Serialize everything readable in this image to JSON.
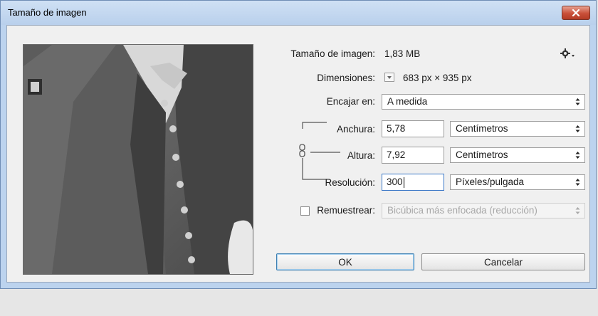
{
  "window": {
    "title": "Tamaño de imagen",
    "close_icon": "close-icon"
  },
  "image_size": {
    "label": "Tamaño de imagen:",
    "value": "1,83 MB"
  },
  "dimensions": {
    "label": "Dimensiones:",
    "value": "683 px × 935 px"
  },
  "fit_to": {
    "label": "Encajar en:",
    "selected": "A medida"
  },
  "width": {
    "label": "Anchura:",
    "value": "5,78",
    "unit": "Centímetros"
  },
  "height": {
    "label": "Altura:",
    "value": "7,92",
    "unit": "Centímetros"
  },
  "resolution": {
    "label": "Resolución:",
    "value": "300",
    "unit": "Píxeles/pulgada"
  },
  "resample": {
    "label": "Remuestrear:",
    "checked": false,
    "method": "Bicúbica más enfocada (reducción)"
  },
  "buttons": {
    "ok": "OK",
    "cancel": "Cancelar"
  },
  "colors": {
    "titlebar": "#bcd3ee",
    "client": "#f0f0f0",
    "close": "#c9503a",
    "focus": "#3b78c7"
  }
}
